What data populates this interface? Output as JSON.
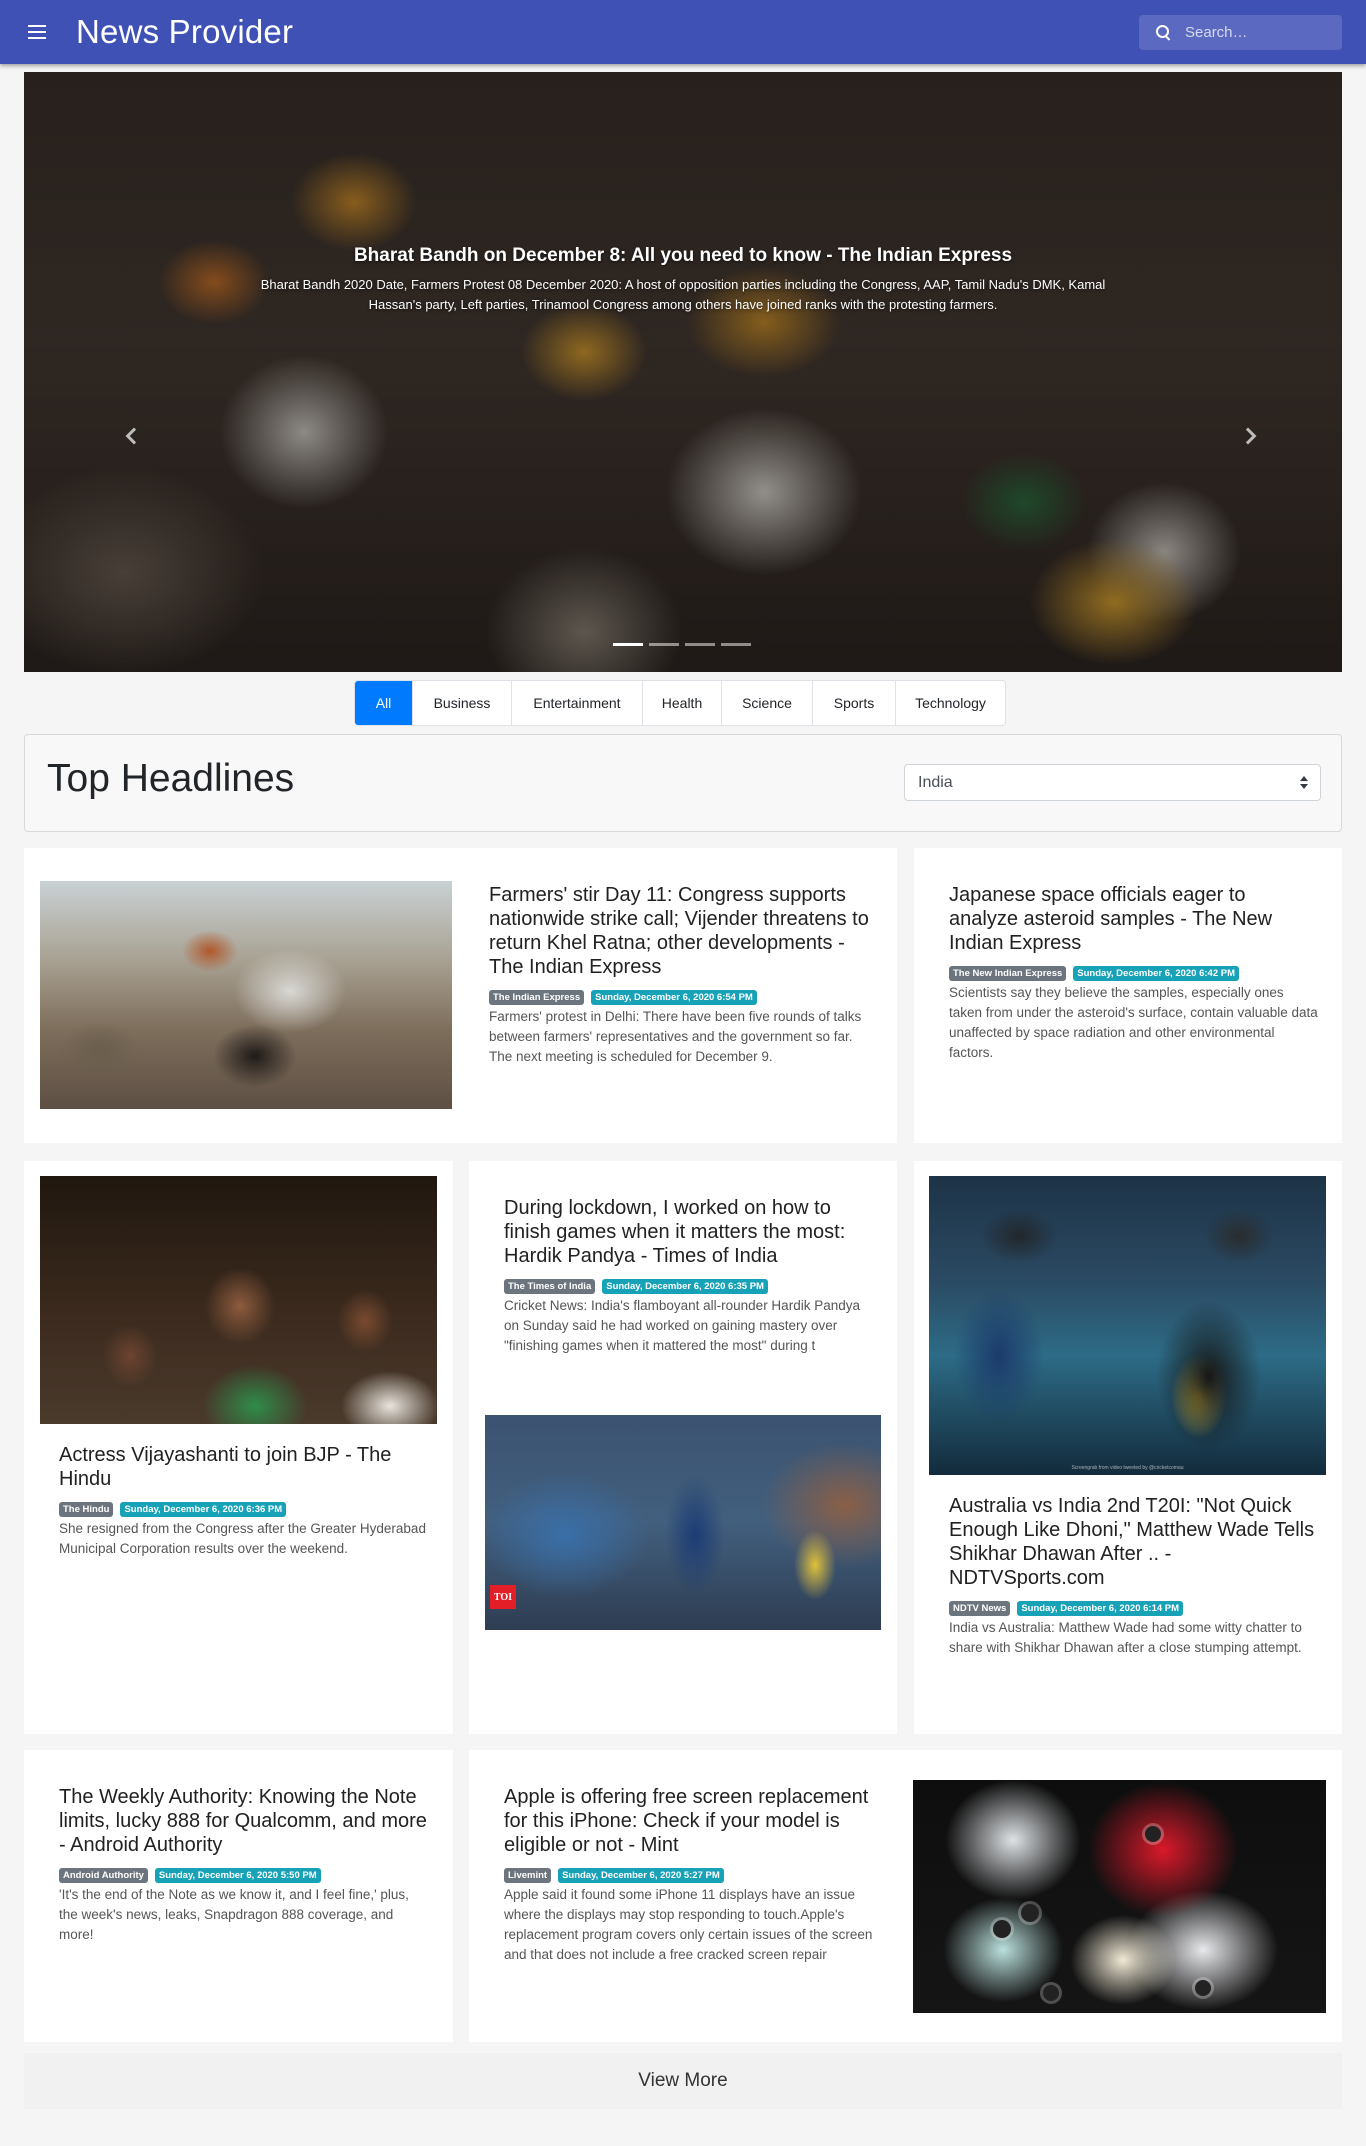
{
  "app": {
    "title": "News Provider"
  },
  "search": {
    "placeholder": "Search…"
  },
  "carousel": {
    "title": "Bharat Bandh on December 8: All you need to know - The Indian Express",
    "description": "Bharat Bandh 2020 Date, Farmers Protest 08 December 2020: A host of opposition parties including the Congress, AAP, Tamil Nadu's DMK, Kamal Hassan's party, Left parties, Trinamool Congress among others have joined ranks with the protesting farmers.",
    "indicator_count": 4,
    "active_index": 0
  },
  "categories": [
    {
      "label": "All",
      "active": true
    },
    {
      "label": "Business",
      "active": false
    },
    {
      "label": "Entertainment",
      "active": false
    },
    {
      "label": "Health",
      "active": false
    },
    {
      "label": "Science",
      "active": false
    },
    {
      "label": "Sports",
      "active": false
    },
    {
      "label": "Technology",
      "active": false
    }
  ],
  "headlines": {
    "title": "Top Headlines",
    "country": "India"
  },
  "articles": [
    {
      "title": "Farmers' stir Day 11: Congress supports nationwide strike call; Vijender threatens to return Khel Ratna; other developments - The Indian Express",
      "source": "The Indian Express",
      "date": "Sunday, December 6, 2020 6:54 PM",
      "description": "Farmers' protest in Delhi: There have been five rounds of talks between farmers' representatives and the government so far. The next meeting is scheduled for December 9."
    },
    {
      "title": "Japanese space officials eager to analyze asteroid samples - The New Indian Express",
      "source": "The New Indian Express",
      "date": "Sunday, December 6, 2020 6:42 PM",
      "description": "Scientists say they believe the samples, especially ones taken from under the asteroid's surface, contain valuable data unaffected by space radiation and other environmental factors."
    },
    {
      "title": "Actress Vijayashanti to join BJP - The Hindu",
      "source": "The Hindu",
      "date": "Sunday, December 6, 2020 6:36 PM",
      "description": "She resigned from the Congress after the Greater Hyderabad Municipal Corporation results over the weekend."
    },
    {
      "title": "During lockdown, I worked on how to finish games when it matters the most: Hardik Pandya - Times of India",
      "source": "The Times of India",
      "date": "Sunday, December 6, 2020 6:35 PM",
      "description": "Cricket News: India's flamboyant all-rounder Hardik Pandya on Sunday said he had worked on gaining mastery over \"finishing games when it mattered the most\" during t",
      "image_badge": "TOI"
    },
    {
      "title": "Australia vs India 2nd T20I: \"Not Quick Enough Like Dhoni,\" Matthew Wade Tells Shikhar Dhawan After .. - NDTVSports.com",
      "source": "NDTV News",
      "date": "Sunday, December 6, 2020 6:14 PM",
      "description": "India vs Australia: Matthew Wade had some witty chatter to share with Shikhar Dhawan after a close stumping attempt.",
      "image_caption": "Screengrab from video tweeted by @cricketcomau"
    },
    {
      "title": "The Weekly Authority: Knowing the Note limits, lucky 888 for Qualcomm, and more - Android Authority",
      "source": "Android Authority",
      "date": "Sunday, December 6, 2020 5:50 PM",
      "description": "'It's the end of the Note as we know it, and I feel fine,' plus, the week's news, leaks, Snapdragon 888 coverage, and more!"
    },
    {
      "title": "Apple is offering free screen replacement for this iPhone: Check if your model is eligible or not - Mint",
      "source": "Livemint",
      "date": "Sunday, December 6, 2020 5:27 PM",
      "description": "Apple said it found some iPhone 11 displays have an issue where the displays may stop responding to touch.Apple's replacement program covers only certain issues of the screen and that does not include a free cracked screen repair"
    }
  ],
  "view_more": {
    "label": "View More"
  },
  "colors": {
    "appbar": "#3f51b5",
    "tab_active": "#007bff",
    "badge_source": "#6c757d",
    "badge_date": "#17a2b8"
  }
}
